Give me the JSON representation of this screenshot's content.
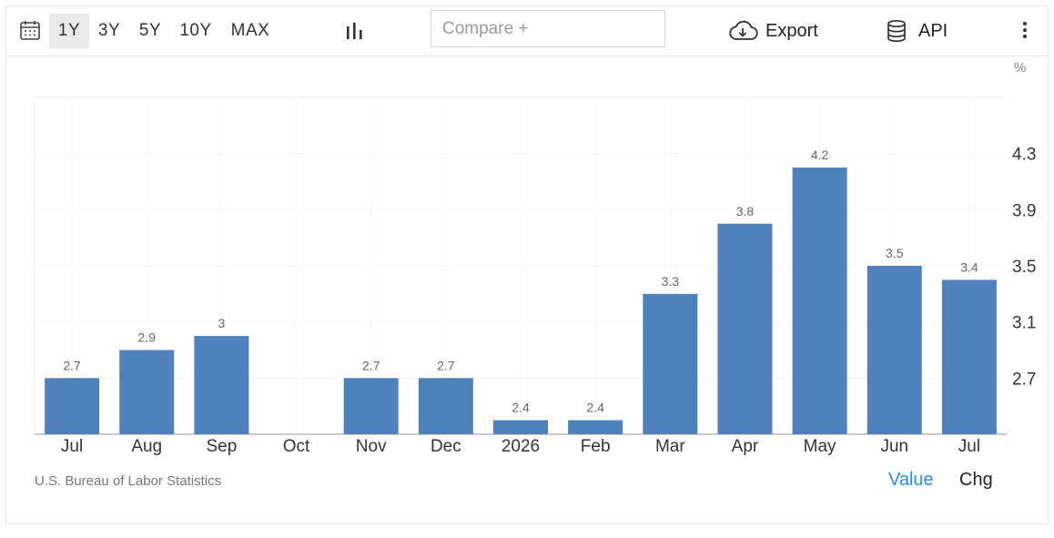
{
  "toolbar": {
    "ranges": [
      "1Y",
      "3Y",
      "5Y",
      "10Y",
      "MAX"
    ],
    "active_range": "1Y",
    "compare_placeholder": "Compare +",
    "export_label": "Export",
    "api_label": "API",
    "icons": [
      "calendar-icon",
      "bar-chart-icon",
      "cloud-download-icon",
      "database-icon",
      "more-vertical-icon"
    ]
  },
  "unit_label": "%",
  "colors": {
    "bar": "#4f81bd",
    "active_tab_bg": "#e9e9e9",
    "value_toggle": "#2a8ee0"
  },
  "chart_data": {
    "type": "bar",
    "categories": [
      "Jul",
      "Aug",
      "Sep",
      "Oct",
      "Nov",
      "Dec",
      "2026",
      "Feb",
      "Mar",
      "Apr",
      "May",
      "Jun",
      "Jul"
    ],
    "values": [
      2.7,
      2.9,
      3,
      null,
      2.7,
      2.7,
      2.4,
      2.4,
      3.3,
      3.8,
      4.2,
      3.5,
      3.4
    ],
    "value_labels": [
      "2.7",
      "2.9",
      "3",
      "",
      "2.7",
      "2.7",
      "2.4",
      "2.4",
      "3.3",
      "3.8",
      "4.2",
      "3.5",
      "3.4"
    ],
    "y_ticks": [
      2.7,
      3.1,
      3.5,
      3.9,
      4.3
    ],
    "y_tick_labels": [
      "2.7",
      "3.1",
      "3.5",
      "3.9",
      "4.3"
    ],
    "ylim": [
      2.3,
      4.7
    ],
    "y_axis_side": "right",
    "grid": true,
    "title": "",
    "xlabel": "",
    "ylabel": "%"
  },
  "footer": {
    "source": "U.S. Bureau of Labor Statistics",
    "toggle_value": "Value",
    "toggle_chg": "Chg"
  }
}
